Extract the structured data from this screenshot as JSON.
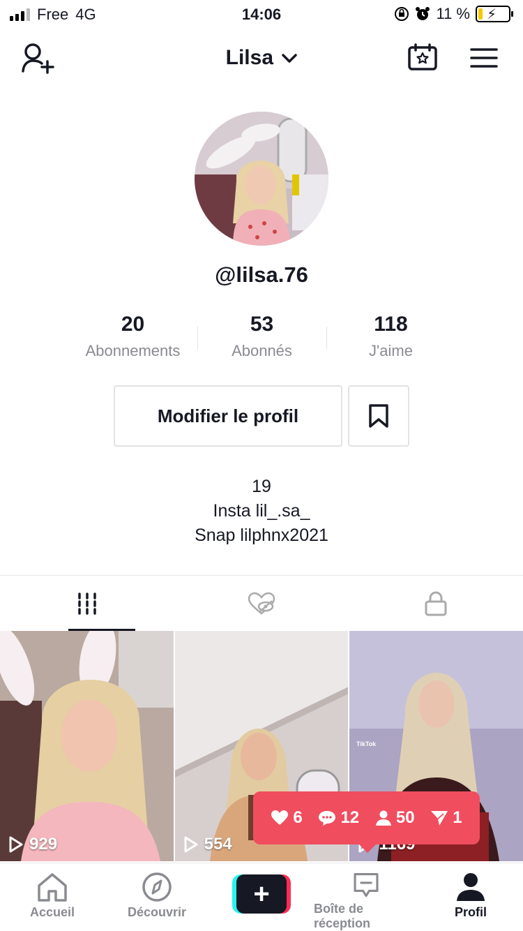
{
  "status_bar": {
    "carrier": "Free",
    "network": "4G",
    "time": "14:06",
    "battery": "11 %"
  },
  "header": {
    "title": "Lilsa"
  },
  "profile": {
    "username": "@lilsa.76",
    "stats": [
      {
        "value": "20",
        "label": "Abonnements"
      },
      {
        "value": "53",
        "label": "Abonnés"
      },
      {
        "value": "118",
        "label": "J'aime"
      }
    ],
    "edit_button": "Modifier le profil",
    "bio": [
      "19",
      "Insta lil_.sa_",
      "Snap lilphnx2021"
    ]
  },
  "videos": [
    {
      "views": "929"
    },
    {
      "views": "554"
    },
    {
      "views": "1169"
    }
  ],
  "notification": {
    "likes": "6",
    "comments": "12",
    "followers": "50",
    "mentions": "1"
  },
  "bottom_nav": {
    "home": "Accueil",
    "discover": "Découvrir",
    "inbox": "Boîte de réception",
    "profile": "Profil"
  },
  "colors": {
    "accent": "#fe2c55",
    "cyan": "#25f4ee",
    "notification": "#f04d5f",
    "text": "#161823",
    "muted": "#8a8b91"
  }
}
